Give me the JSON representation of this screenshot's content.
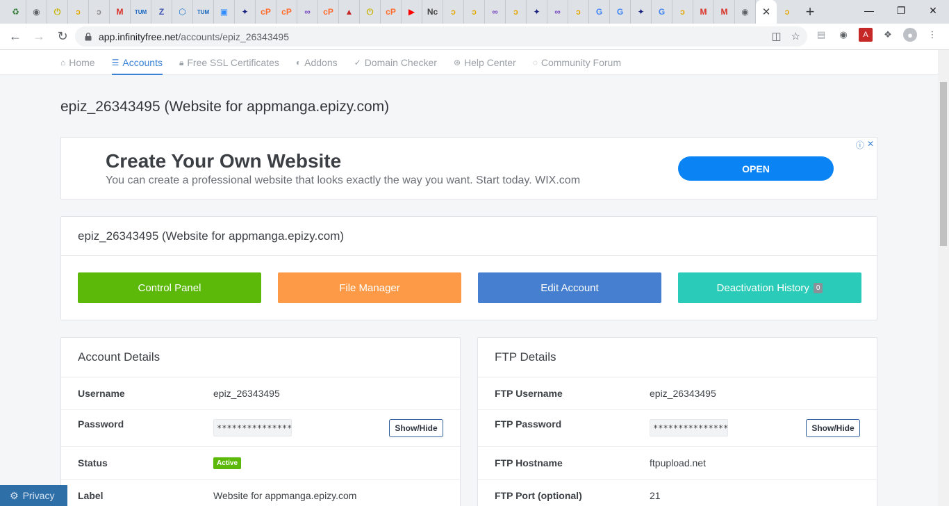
{
  "browser": {
    "url_host": "app.infinityfree.net",
    "url_path": "/accounts/epiz_26343495",
    "tabs": [
      {
        "icon": "recycle-icon",
        "glyph": "♻",
        "color": "#2e7d32"
      },
      {
        "icon": "globe-icon",
        "glyph": "◉",
        "color": "#5f6368"
      },
      {
        "icon": "power-icon",
        "glyph": "⏻",
        "color": "#c8b400"
      },
      {
        "icon": "feather-icon",
        "glyph": "ↄ",
        "color": "#e6a800"
      },
      {
        "icon": "feather-icon",
        "glyph": "ↄ",
        "color": "#888"
      },
      {
        "icon": "gmail-icon",
        "glyph": "M",
        "color": "#d93025"
      },
      {
        "icon": "tum-icon",
        "glyph": "TUM",
        "color": "#1565c0"
      },
      {
        "icon": "z-icon",
        "glyph": "Z",
        "color": "#3f51b5"
      },
      {
        "icon": "bitbucket-icon",
        "glyph": "⬡",
        "color": "#1976d2"
      },
      {
        "icon": "tum-icon",
        "glyph": "TUM",
        "color": "#1565c0"
      },
      {
        "icon": "zoom-icon",
        "glyph": "▣",
        "color": "#2d8cff"
      },
      {
        "icon": "fairy-icon",
        "glyph": "✦",
        "color": "#1a237e"
      },
      {
        "icon": "cpanel-icon",
        "glyph": "cP",
        "color": "#ff6c2c"
      },
      {
        "icon": "cpanel-icon",
        "glyph": "cP",
        "color": "#ff6c2c"
      },
      {
        "icon": "infinity-icon",
        "glyph": "∞",
        "color": "#7b4cc2"
      },
      {
        "icon": "cpanel-icon",
        "glyph": "cP",
        "color": "#ff6c2c"
      },
      {
        "icon": "ppra-icon",
        "glyph": "▲",
        "color": "#c62828"
      },
      {
        "icon": "power-icon",
        "glyph": "⏻",
        "color": "#c8b400"
      },
      {
        "icon": "cpanel-icon",
        "glyph": "cP",
        "color": "#ff6c2c"
      },
      {
        "icon": "youtube-icon",
        "glyph": "▶",
        "color": "#ff0000"
      },
      {
        "icon": "nc-icon",
        "glyph": "Nc",
        "color": "#444"
      },
      {
        "icon": "feather-icon",
        "glyph": "ↄ",
        "color": "#e6a800"
      },
      {
        "icon": "feather-icon",
        "glyph": "ↄ",
        "color": "#e6a800"
      },
      {
        "icon": "infinity-icon",
        "glyph": "∞",
        "color": "#7b4cc2"
      },
      {
        "icon": "feather-icon",
        "glyph": "ↄ",
        "color": "#e6a800"
      },
      {
        "icon": "fairy-icon",
        "glyph": "✦",
        "color": "#1a237e"
      },
      {
        "icon": "infinity-icon",
        "glyph": "∞",
        "color": "#7b4cc2"
      },
      {
        "icon": "feather-icon",
        "glyph": "ↄ",
        "color": "#e6a800"
      },
      {
        "icon": "google-icon",
        "glyph": "G",
        "color": "#4285f4"
      },
      {
        "icon": "google-icon",
        "glyph": "G",
        "color": "#4285f4"
      },
      {
        "icon": "fairy-icon",
        "glyph": "✦",
        "color": "#1a237e"
      },
      {
        "icon": "google-icon",
        "glyph": "G",
        "color": "#4285f4"
      },
      {
        "icon": "feather-icon",
        "glyph": "ↄ",
        "color": "#e6a800"
      },
      {
        "icon": "gmail-icon",
        "glyph": "M",
        "color": "#d93025"
      },
      {
        "icon": "gmail-icon",
        "glyph": "M",
        "color": "#d93025"
      },
      {
        "icon": "globe-icon",
        "glyph": "◉",
        "color": "#5f6368"
      }
    ],
    "after_tabs": [
      {
        "icon": "feather-icon",
        "glyph": "ↄ",
        "color": "#e6a800"
      }
    ]
  },
  "nav": {
    "items": [
      {
        "label": "Home",
        "icon": "home-icon",
        "glyph": "⌂"
      },
      {
        "label": "Accounts",
        "icon": "server-icon",
        "glyph": "☰"
      },
      {
        "label": "Free SSL Certificates",
        "icon": "lock-icon",
        "glyph": "🔒︎"
      },
      {
        "label": "Addons",
        "icon": "toggle-icon",
        "glyph": "◐"
      },
      {
        "label": "Domain Checker",
        "icon": "check-circle-icon",
        "glyph": "✓"
      },
      {
        "label": "Help Center",
        "icon": "lifebuoy-icon",
        "glyph": "⊛"
      },
      {
        "label": "Community Forum",
        "icon": "chat-icon",
        "glyph": "◌"
      }
    ]
  },
  "page": {
    "title": "epiz_26343495 (Website for appmanga.epizy.com)"
  },
  "ad": {
    "title": "Create Your Own Website",
    "text": "You can create a professional website that looks exactly the way you want. Start today. WIX.com",
    "button": "OPEN"
  },
  "account_card": {
    "header": "epiz_26343495 (Website for appmanga.epizy.com)",
    "buttons": {
      "control_panel": "Control Panel",
      "file_manager": "File Manager",
      "edit_account": "Edit Account",
      "deactivation_history": "Deactivation History",
      "deactivation_count": "0"
    },
    "colors": {
      "control_panel": "#5cb90a",
      "file_manager": "#fd9a47",
      "edit_account": "#467fcf",
      "deactivation_history": "#2bcbba"
    }
  },
  "account_details": {
    "header": "Account Details",
    "username_label": "Username",
    "username": "epiz_26343495",
    "password_label": "Password",
    "password_mask": "***************",
    "show_hide": "Show/Hide",
    "status_label": "Status",
    "status": "Active",
    "label_label": "Label",
    "label": "Website for appmanga.epizy.com"
  },
  "ftp_details": {
    "header": "FTP Details",
    "username_label": "FTP Username",
    "username": "epiz_26343495",
    "password_label": "FTP Password",
    "password_mask": "***************",
    "show_hide": "Show/Hide",
    "hostname_label": "FTP Hostname",
    "hostname": "ftpupload.net",
    "port_label": "FTP Port (optional)",
    "port": "21"
  },
  "privacy": {
    "label": "Privacy"
  }
}
